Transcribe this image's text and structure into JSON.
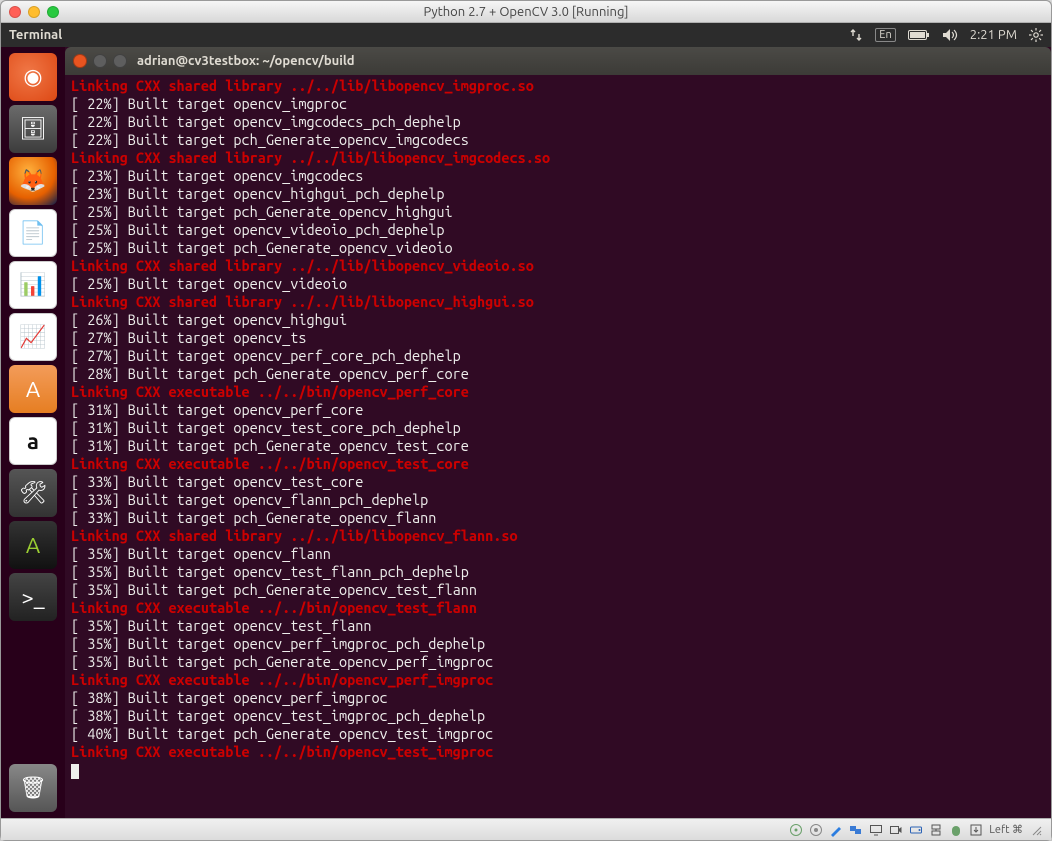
{
  "mac": {
    "title": "Python 2.7 + OpenCV 3.0 [Running]"
  },
  "ubuntu_panel": {
    "app_name": "Terminal",
    "lang": "En",
    "time": "2:21 PM"
  },
  "launcher": [
    {
      "name": "ubuntu-dash-icon",
      "glyph": "◉"
    },
    {
      "name": "files-icon",
      "glyph": "🗄"
    },
    {
      "name": "firefox-icon",
      "glyph": "🦊"
    },
    {
      "name": "writer-icon",
      "glyph": "📄"
    },
    {
      "name": "calc-icon",
      "glyph": "📊"
    },
    {
      "name": "impress-icon",
      "glyph": "📈"
    },
    {
      "name": "software-center-icon",
      "glyph": "A"
    },
    {
      "name": "amazon-icon",
      "glyph": "a"
    },
    {
      "name": "settings-icon",
      "glyph": "🛠"
    },
    {
      "name": "software-updater-icon",
      "glyph": "A"
    },
    {
      "name": "terminal-icon",
      "glyph": ">_"
    },
    {
      "name": "trash-icon",
      "glyph": "🗑"
    }
  ],
  "terminal": {
    "title": "adrian@cv3testbox: ~/opencv/build",
    "lines": [
      {
        "type": "link",
        "text": "Linking CXX shared library ../../lib/libopencv_imgproc.so"
      },
      {
        "type": "built",
        "pct": "22%",
        "text": "Built target opencv_imgproc"
      },
      {
        "type": "built",
        "pct": "22%",
        "text": "Built target opencv_imgcodecs_pch_dephelp"
      },
      {
        "type": "built",
        "pct": "22%",
        "text": "Built target pch_Generate_opencv_imgcodecs"
      },
      {
        "type": "link",
        "text": "Linking CXX shared library ../../lib/libopencv_imgcodecs.so"
      },
      {
        "type": "built",
        "pct": "23%",
        "text": "Built target opencv_imgcodecs"
      },
      {
        "type": "built",
        "pct": "23%",
        "text": "Built target opencv_highgui_pch_dephelp"
      },
      {
        "type": "built",
        "pct": "25%",
        "text": "Built target pch_Generate_opencv_highgui"
      },
      {
        "type": "built",
        "pct": "25%",
        "text": "Built target opencv_videoio_pch_dephelp"
      },
      {
        "type": "built",
        "pct": "25%",
        "text": "Built target pch_Generate_opencv_videoio"
      },
      {
        "type": "link",
        "text": "Linking CXX shared library ../../lib/libopencv_videoio.so"
      },
      {
        "type": "built",
        "pct": "25%",
        "text": "Built target opencv_videoio"
      },
      {
        "type": "link",
        "text": "Linking CXX shared library ../../lib/libopencv_highgui.so"
      },
      {
        "type": "built",
        "pct": "26%",
        "text": "Built target opencv_highgui"
      },
      {
        "type": "built",
        "pct": "27%",
        "text": "Built target opencv_ts"
      },
      {
        "type": "built",
        "pct": "27%",
        "text": "Built target opencv_perf_core_pch_dephelp"
      },
      {
        "type": "built",
        "pct": "28%",
        "text": "Built target pch_Generate_opencv_perf_core"
      },
      {
        "type": "link",
        "text": "Linking CXX executable ../../bin/opencv_perf_core"
      },
      {
        "type": "built",
        "pct": "31%",
        "text": "Built target opencv_perf_core"
      },
      {
        "type": "built",
        "pct": "31%",
        "text": "Built target opencv_test_core_pch_dephelp"
      },
      {
        "type": "built",
        "pct": "31%",
        "text": "Built target pch_Generate_opencv_test_core"
      },
      {
        "type": "link",
        "text": "Linking CXX executable ../../bin/opencv_test_core"
      },
      {
        "type": "built",
        "pct": "33%",
        "text": "Built target opencv_test_core"
      },
      {
        "type": "built",
        "pct": "33%",
        "text": "Built target opencv_flann_pch_dephelp"
      },
      {
        "type": "built",
        "pct": "33%",
        "text": "Built target pch_Generate_opencv_flann"
      },
      {
        "type": "link",
        "text": "Linking CXX shared library ../../lib/libopencv_flann.so"
      },
      {
        "type": "built",
        "pct": "35%",
        "text": "Built target opencv_flann"
      },
      {
        "type": "built",
        "pct": "35%",
        "text": "Built target opencv_test_flann_pch_dephelp"
      },
      {
        "type": "built",
        "pct": "35%",
        "text": "Built target pch_Generate_opencv_test_flann"
      },
      {
        "type": "link",
        "text": "Linking CXX executable ../../bin/opencv_test_flann"
      },
      {
        "type": "built",
        "pct": "35%",
        "text": "Built target opencv_test_flann"
      },
      {
        "type": "built",
        "pct": "35%",
        "text": "Built target opencv_perf_imgproc_pch_dephelp"
      },
      {
        "type": "built",
        "pct": "35%",
        "text": "Built target pch_Generate_opencv_perf_imgproc"
      },
      {
        "type": "link",
        "text": "Linking CXX executable ../../bin/opencv_perf_imgproc"
      },
      {
        "type": "built",
        "pct": "38%",
        "text": "Built target opencv_perf_imgproc"
      },
      {
        "type": "built",
        "pct": "38%",
        "text": "Built target opencv_test_imgproc_pch_dephelp"
      },
      {
        "type": "built",
        "pct": "40%",
        "text": "Built target pch_Generate_opencv_test_imgproc"
      },
      {
        "type": "link",
        "text": "Linking CXX executable ../../bin/opencv_test_imgproc"
      }
    ]
  },
  "statusbar": {
    "left_label": "Left ⌘"
  }
}
